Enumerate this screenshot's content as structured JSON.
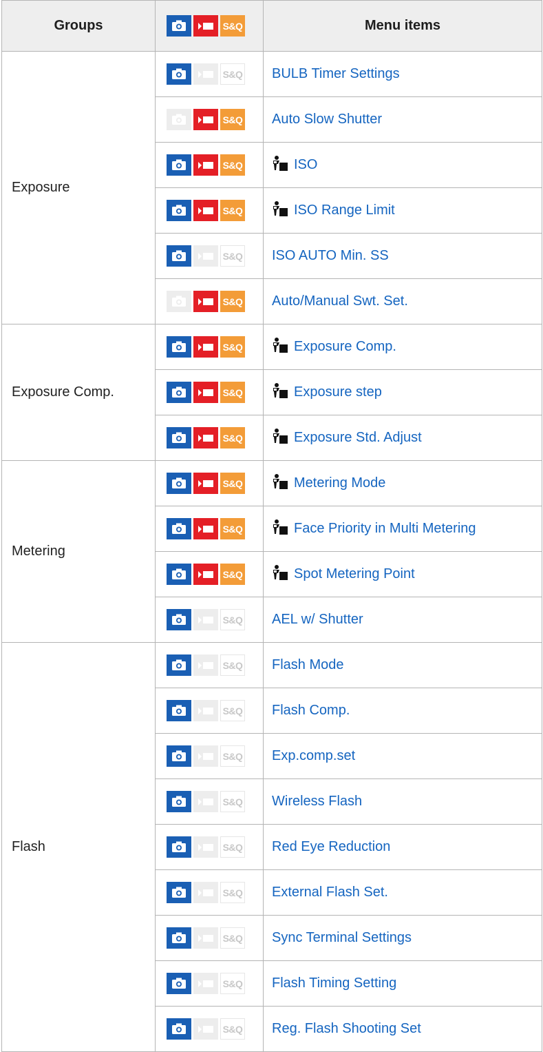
{
  "header": {
    "groups": "Groups",
    "menu_items": "Menu items",
    "sq": "S&Q"
  },
  "colors": {
    "photo_on": "#1a5fb4",
    "movie_on": "#e41f26",
    "sq_on": "#f39c38",
    "link": "#1565c0",
    "header_bg": "#eeeeee"
  },
  "icons": {
    "photo": "camera-icon",
    "movie": "movie-icon",
    "sq": "s-and-q-icon",
    "pasm": "exposure-mode-icon"
  },
  "groups": [
    {
      "name": "Exposure",
      "items": [
        {
          "label": "BULB Timer Settings",
          "photo": true,
          "movie": false,
          "sq": false,
          "pasm": false
        },
        {
          "label": "Auto Slow Shutter",
          "photo": false,
          "movie": true,
          "sq": true,
          "pasm": false
        },
        {
          "label": "ISO",
          "photo": true,
          "movie": true,
          "sq": true,
          "pasm": true
        },
        {
          "label": "ISO Range Limit",
          "photo": true,
          "movie": true,
          "sq": true,
          "pasm": true
        },
        {
          "label": "ISO AUTO Min. SS",
          "photo": true,
          "movie": false,
          "sq": false,
          "pasm": false
        },
        {
          "label": "Auto/Manual Swt. Set.",
          "photo": false,
          "movie": true,
          "sq": true,
          "pasm": false
        }
      ]
    },
    {
      "name": "Exposure Comp.",
      "items": [
        {
          "label": "Exposure Comp.",
          "photo": true,
          "movie": true,
          "sq": true,
          "pasm": true
        },
        {
          "label": "Exposure step",
          "photo": true,
          "movie": true,
          "sq": true,
          "pasm": true
        },
        {
          "label": "Exposure Std. Adjust",
          "photo": true,
          "movie": true,
          "sq": true,
          "pasm": true
        }
      ]
    },
    {
      "name": "Metering",
      "items": [
        {
          "label": "Metering Mode",
          "photo": true,
          "movie": true,
          "sq": true,
          "pasm": true
        },
        {
          "label": "Face Priority in Multi Metering",
          "photo": true,
          "movie": true,
          "sq": true,
          "pasm": true
        },
        {
          "label": "Spot Metering Point",
          "photo": true,
          "movie": true,
          "sq": true,
          "pasm": true
        },
        {
          "label": "AEL w/ Shutter",
          "photo": true,
          "movie": false,
          "sq": false,
          "pasm": false
        }
      ]
    },
    {
      "name": "Flash",
      "items": [
        {
          "label": "Flash Mode",
          "photo": true,
          "movie": false,
          "sq": false,
          "pasm": false
        },
        {
          "label": "Flash Comp.",
          "photo": true,
          "movie": false,
          "sq": false,
          "pasm": false
        },
        {
          "label": "Exp.comp.set",
          "photo": true,
          "movie": false,
          "sq": false,
          "pasm": false
        },
        {
          "label": "Wireless Flash",
          "photo": true,
          "movie": false,
          "sq": false,
          "pasm": false
        },
        {
          "label": "Red Eye Reduction",
          "photo": true,
          "movie": false,
          "sq": false,
          "pasm": false
        },
        {
          "label": "External Flash Set.",
          "photo": true,
          "movie": false,
          "sq": false,
          "pasm": false
        },
        {
          "label": "Sync Terminal Settings",
          "photo": true,
          "movie": false,
          "sq": false,
          "pasm": false
        },
        {
          "label": "Flash Timing Setting",
          "photo": true,
          "movie": false,
          "sq": false,
          "pasm": false
        },
        {
          "label": "Reg. Flash Shooting Set",
          "photo": true,
          "movie": false,
          "sq": false,
          "pasm": false
        }
      ]
    }
  ]
}
